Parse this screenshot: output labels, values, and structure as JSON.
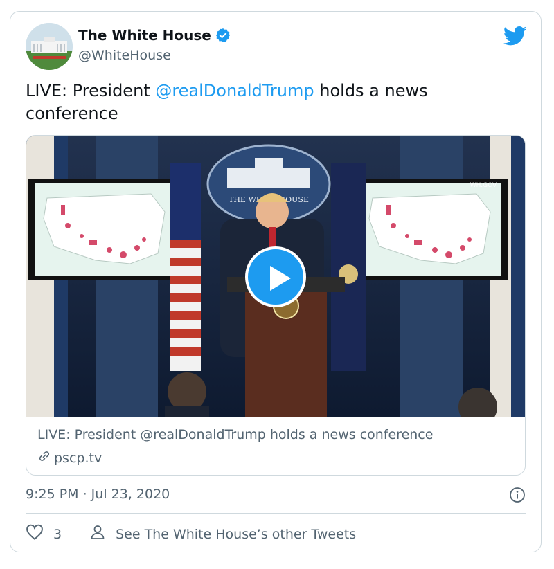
{
  "author": {
    "display_name": "The White House",
    "handle": "@WhiteHouse",
    "verified": true
  },
  "tweet": {
    "text_prefix": "LIVE: President ",
    "mention": "@realDonaldTrump",
    "text_suffix": " holds a news conference"
  },
  "video": {
    "seal_text": "THE WHITE HOUSE",
    "watermark": "WH.GOV"
  },
  "link_card": {
    "title": "LIVE: President @realDonaldTrump holds a news conference",
    "domain": "pscp.tv"
  },
  "timestamp": "9:25 PM · Jul 23, 2020",
  "actions": {
    "like_count": "3",
    "other_tweets_label": "See The White House’s other Tweets"
  },
  "colors": {
    "accent": "#1d9bf0",
    "text_secondary": "#536471",
    "border": "#cfd9de"
  },
  "icons": [
    "verified-badge-icon",
    "twitter-bird-icon",
    "play-icon",
    "link-icon",
    "info-icon",
    "heart-icon",
    "person-icon"
  ]
}
